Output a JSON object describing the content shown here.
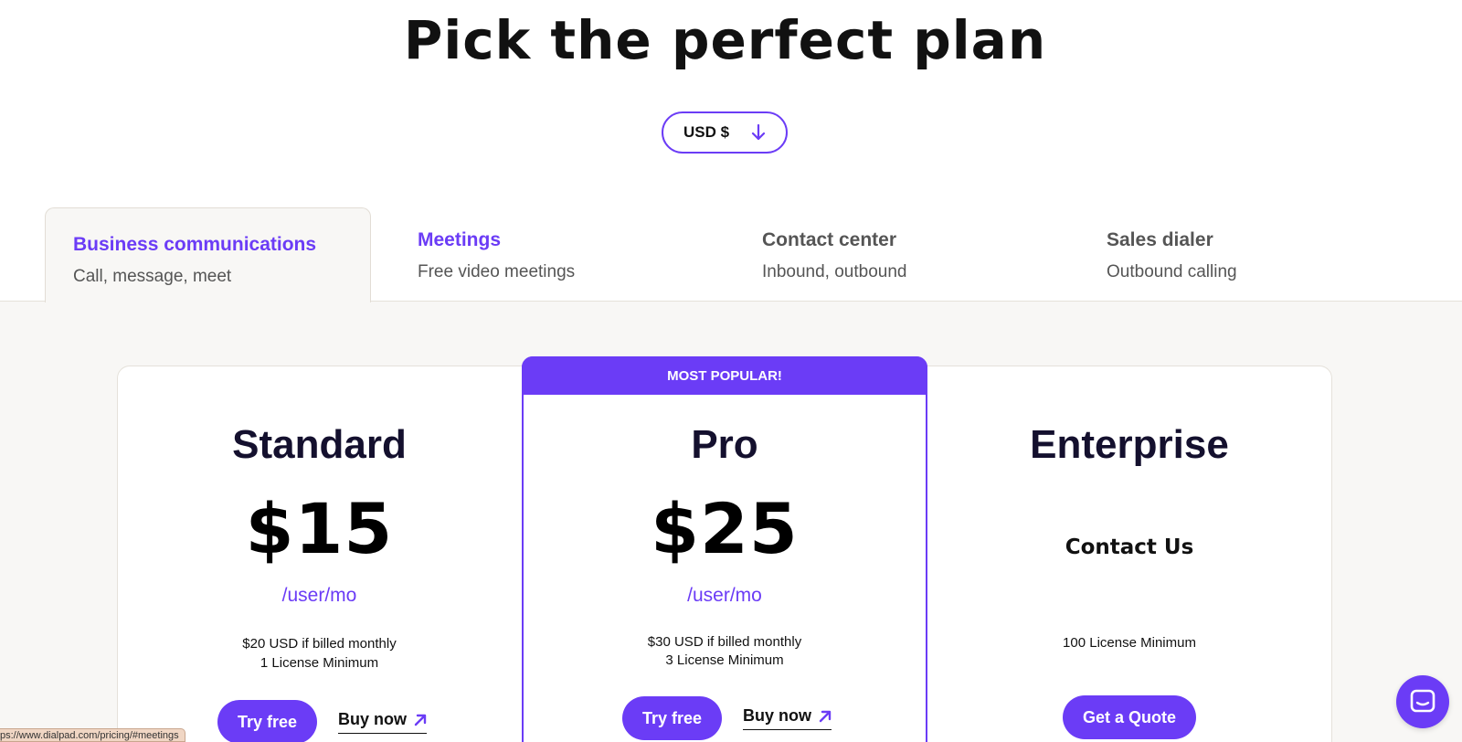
{
  "page_title": "Pick the perfect plan",
  "currency": {
    "selected": "USD $",
    "icon": "arrow-down-icon"
  },
  "tabs": [
    {
      "title": "Business communications",
      "subtitle": "Call, message, meet",
      "active": true
    },
    {
      "title": "Meetings",
      "subtitle": "Free video meetings",
      "active": false
    },
    {
      "title": "Contact center",
      "subtitle": "Inbound, outbound",
      "active": false
    },
    {
      "title": "Sales dialer",
      "subtitle": "Outbound calling",
      "active": false
    }
  ],
  "plans": {
    "standard": {
      "name": "Standard",
      "price": "$15",
      "unit": "/user/mo",
      "note1": "$20 USD if billed monthly",
      "note2": "1 License Minimum",
      "primary_cta": "Try free",
      "secondary_cta": "Buy now"
    },
    "pro": {
      "badge": "MOST POPULAR!",
      "name": "Pro",
      "price": "$25",
      "unit": "/user/mo",
      "note1": "$30 USD if billed monthly",
      "note2": "3 License Minimum",
      "primary_cta": "Try free",
      "secondary_cta": "Buy now"
    },
    "enterprise": {
      "name": "Enterprise",
      "contact": "Contact Us",
      "note1": "100 License Minimum",
      "primary_cta": "Get a Quote"
    }
  },
  "status_bar": {
    "url": "ps://www.dialpad.com/pricing/#meetings"
  },
  "colors": {
    "accent": "#6b3cf6",
    "band_bg": "#f8f7f5",
    "text_dark": "#14102e"
  }
}
